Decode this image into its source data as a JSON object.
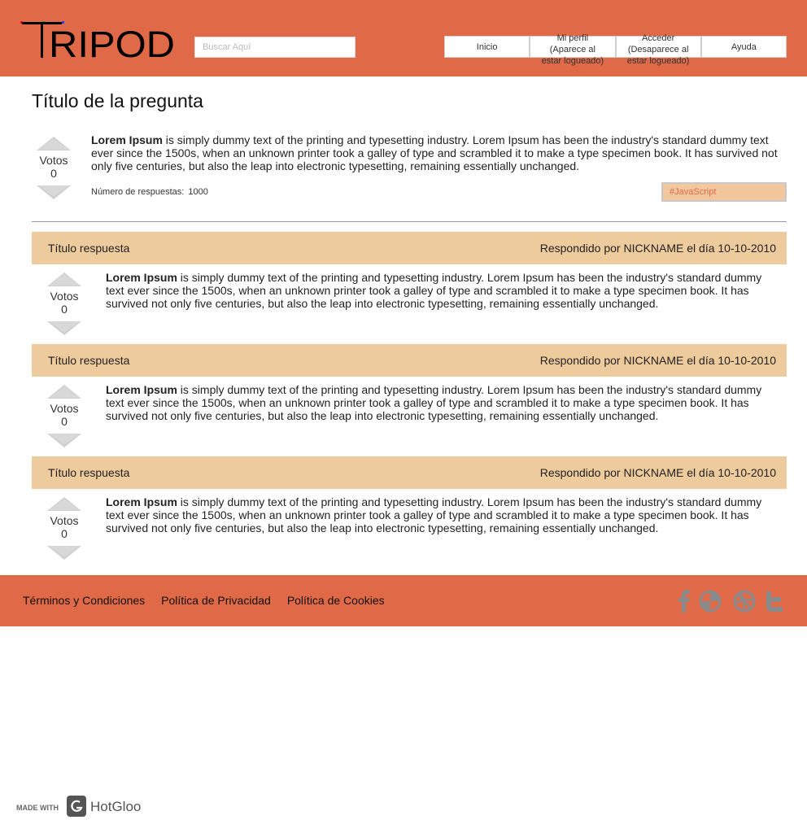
{
  "header": {
    "logo_text": "TRIPOD",
    "search_placeholder": "Buscar Aquí",
    "nav": [
      {
        "label": "Inicio"
      },
      {
        "label": "Mi perfil\n(Aparece al\nestar logueado)"
      },
      {
        "label": "Acceder\n(Desaparece al\nestar logueado)"
      },
      {
        "label": "Ayuda"
      }
    ]
  },
  "question": {
    "title": "Título de la pregunta",
    "votes_label": "Votos",
    "votes": "0",
    "body_bold": "Lorem Ipsum",
    "body_text": " is simply dummy text of the printing and typesetting industry. Lorem Ipsum has been the industry's standard dummy text ever since the 1500s, when an unknown printer took a galley of type and scrambled it to make a type specimen book. It has survived not only five centuries, but also the leap into electronic typesetting, remaining essentially unchanged.",
    "answers_count_label": "Número de respuestas:",
    "answers_count": "1000",
    "tag": "#JavaScript"
  },
  "answers": [
    {
      "title": "Título respuesta",
      "meta": "Respondido por NICKNAME el día 10-10-2010",
      "votes_label": "Votos",
      "votes": "0",
      "body_bold": "Lorem Ipsum",
      "body_text": " is simply dummy text of the printing and typesetting industry. Lorem Ipsum has been the industry's standard dummy text ever since the 1500s, when an unknown printer took a galley of type and scrambled it to make a type specimen book. It has survived not only five centuries, but also the leap into electronic typesetting, remaining essentially unchanged."
    },
    {
      "title": "Título respuesta",
      "meta": "Respondido por NICKNAME el día 10-10-2010",
      "votes_label": "Votos",
      "votes": "0",
      "body_bold": "Lorem Ipsum",
      "body_text": " is simply dummy text of the printing and typesetting industry. Lorem Ipsum has been the industry's standard dummy text ever since the 1500s, when an unknown printer took a galley of type and scrambled it to make a type specimen book. It has survived not only five centuries, but also the leap into electronic typesetting, remaining essentially unchanged."
    },
    {
      "title": "Título respuesta",
      "meta": "Respondido por NICKNAME el día 10-10-2010",
      "votes_label": "Votos",
      "votes": "0",
      "body_bold": "Lorem Ipsum",
      "body_text": " is simply dummy text of the printing and typesetting industry. Lorem Ipsum has been the industry's standard dummy text ever since the 1500s, when an unknown printer took a galley of type and scrambled it to make a type specimen book. It has survived not only five centuries, but also the leap into electronic typesetting, remaining essentially unchanged."
    }
  ],
  "footer": {
    "links": [
      "Términos y Condiciones",
      "Política de Privacidad",
      "Política de Cookies"
    ],
    "social_icons": [
      "facebook-icon",
      "pie-chart-icon",
      "dribbble-icon",
      "twitter-icon"
    ]
  },
  "made_with": {
    "prefix": "MADE WITH",
    "brand": "HotGloo"
  },
  "colors": {
    "header_bg": "#e06a48",
    "answer_bar": "#eecb9d",
    "tag_bg": "#f2c79d",
    "accent": "#e06a48"
  }
}
